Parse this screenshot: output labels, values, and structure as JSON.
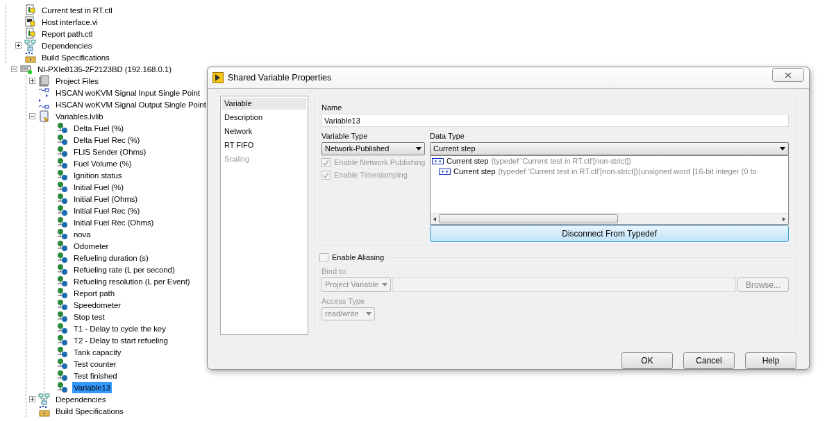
{
  "project_tree": {
    "my_computer_items": [
      {
        "label": "Current test in RT.ctl",
        "kind": "ctl",
        "selected": false
      },
      {
        "label": "Host interface.vi",
        "kind": "vi",
        "selected": false
      },
      {
        "label": "Report path.ctl",
        "kind": "ctl",
        "selected": false
      },
      {
        "label": "Dependencies",
        "kind": "dependencies",
        "expanded": false,
        "selected": false
      },
      {
        "label": "Build Specifications",
        "kind": "build",
        "selected": false
      }
    ],
    "targets": [
      {
        "label": "NI-PXIe8135-2F2123BD (192.168.0.1)",
        "kind": "target",
        "expanded": true,
        "selected": false,
        "children": [
          {
            "label": "Project Files",
            "kind": "folder",
            "expanded": false,
            "selected": false
          },
          {
            "label": "HSCAN woKVM Signal Input Single Point",
            "kind": "io_input",
            "selected": false
          },
          {
            "label": "HSCAN woKVM Signal Output Single Point",
            "kind": "io_output",
            "selected": false
          },
          {
            "label": "Variables.lvlib",
            "kind": "library",
            "expanded": true,
            "selected": false,
            "children": [
              {
                "label": "Delta Fuel (%)",
                "kind": "variable",
                "selected": false
              },
              {
                "label": "Delta Fuel Rec (%)",
                "kind": "variable",
                "selected": false
              },
              {
                "label": "FLIS Sender (Ohms)",
                "kind": "variable",
                "selected": false
              },
              {
                "label": "Fuel Volume (%)",
                "kind": "variable",
                "selected": false
              },
              {
                "label": "Ignition status",
                "kind": "variable",
                "selected": false
              },
              {
                "label": "Initial Fuel (%)",
                "kind": "variable",
                "selected": false
              },
              {
                "label": "Initial Fuel (Ohms)",
                "kind": "variable",
                "selected": false
              },
              {
                "label": "Initial Fuel Rec (%)",
                "kind": "variable",
                "selected": false
              },
              {
                "label": "Initial Fuel Rec (Ohms)",
                "kind": "variable",
                "selected": false
              },
              {
                "label": "nova",
                "kind": "variable",
                "selected": false
              },
              {
                "label": "Odometer",
                "kind": "variable",
                "selected": false
              },
              {
                "label": "Refueling duration (s)",
                "kind": "variable",
                "selected": false
              },
              {
                "label": "Refueling rate (L per second)",
                "kind": "variable",
                "selected": false
              },
              {
                "label": "Refueling resolution (L per Event)",
                "kind": "variable",
                "selected": false
              },
              {
                "label": "Report path",
                "kind": "variable",
                "selected": false
              },
              {
                "label": "Speedometer",
                "kind": "variable",
                "selected": false
              },
              {
                "label": "Stop test",
                "kind": "variable",
                "selected": false
              },
              {
                "label": "T1 - Delay to cycle the key",
                "kind": "variable",
                "selected": false
              },
              {
                "label": "T2 - Delay to start refueling",
                "kind": "variable",
                "selected": false
              },
              {
                "label": "Tank capacity",
                "kind": "variable",
                "selected": false
              },
              {
                "label": "Test counter",
                "kind": "variable",
                "selected": false
              },
              {
                "label": "Test finished",
                "kind": "variable",
                "selected": false
              },
              {
                "label": "Variable13",
                "kind": "variable",
                "selected": true
              }
            ]
          },
          {
            "label": "Dependencies",
            "kind": "dependencies",
            "expanded": false,
            "selected": false
          },
          {
            "label": "Build Specifications",
            "kind": "build",
            "selected": false
          }
        ]
      }
    ]
  },
  "dialog": {
    "title": "Shared Variable Properties",
    "categories": [
      {
        "label": "Variable",
        "selected": true,
        "disabled": false
      },
      {
        "label": "Description",
        "selected": false,
        "disabled": false
      },
      {
        "label": "Network",
        "selected": false,
        "disabled": false
      },
      {
        "label": "RT FIFO",
        "selected": false,
        "disabled": false
      },
      {
        "label": "Scaling",
        "selected": false,
        "disabled": true
      }
    ],
    "name": {
      "label": "Name",
      "value": "Variable13"
    },
    "variable_type": {
      "label": "Variable Type",
      "value": "Network-Published"
    },
    "options": [
      {
        "label": "Enable Network Publishing",
        "checked": true,
        "disabled": true
      },
      {
        "label": "Enable Timestamping",
        "checked": true,
        "disabled": true
      }
    ],
    "data_type": {
      "label": "Data Type",
      "value": "Current step",
      "items": [
        {
          "name": "Current step",
          "detail": "(typedef 'Current test in RT.ctl'[non-strict])",
          "children": [
            {
              "name": "Current step",
              "detail": "(typedef 'Current test in RT.ctl'[non-strict])(unsigned word [16-bit integer (0 to"
            }
          ]
        }
      ]
    },
    "disconnect_button": "Disconnect From Typedef",
    "aliasing": {
      "label": "Enable Aliasing",
      "checked": false,
      "disabled": true,
      "bind_label": "Bind to:",
      "bind_value": "Project Variable",
      "browse_button": "Browse...",
      "access_label": "Access Type",
      "access_value": "read/write"
    },
    "buttons": [
      "OK",
      "Cancel",
      "Help"
    ]
  }
}
